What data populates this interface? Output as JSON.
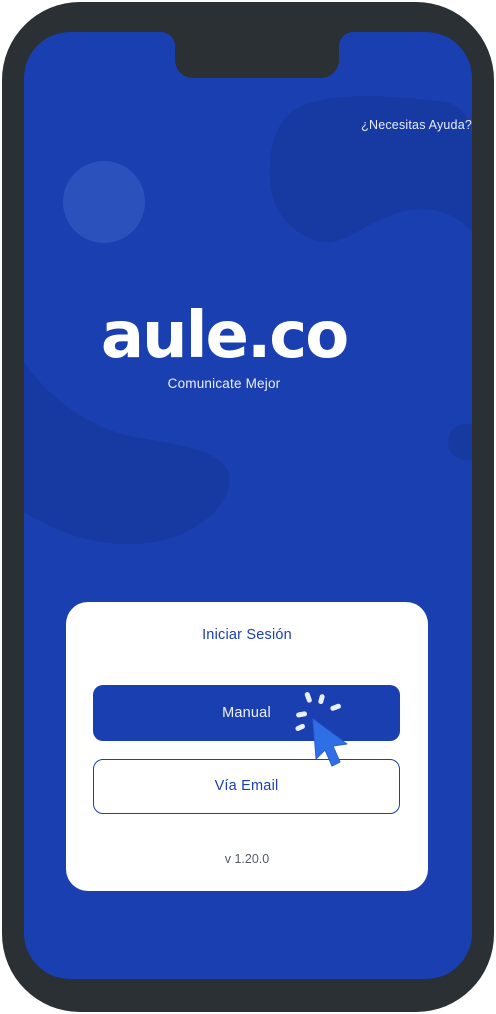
{
  "header": {
    "help_link": "¿Necesitas Ayuda?"
  },
  "brand": {
    "logo": "aule.co",
    "tagline": "Comunicate Mejor"
  },
  "login_card": {
    "title": "Iniciar Sesión",
    "manual_button": "Manual",
    "email_button": "Vía Email",
    "version": "v 1.20.0"
  },
  "colors": {
    "primary": "#1a3fb0",
    "frame": "#2a3034",
    "card": "#ffffff",
    "cursor": "#2f6fe6"
  },
  "icons": {
    "pointer": "click-cursor-icon"
  }
}
